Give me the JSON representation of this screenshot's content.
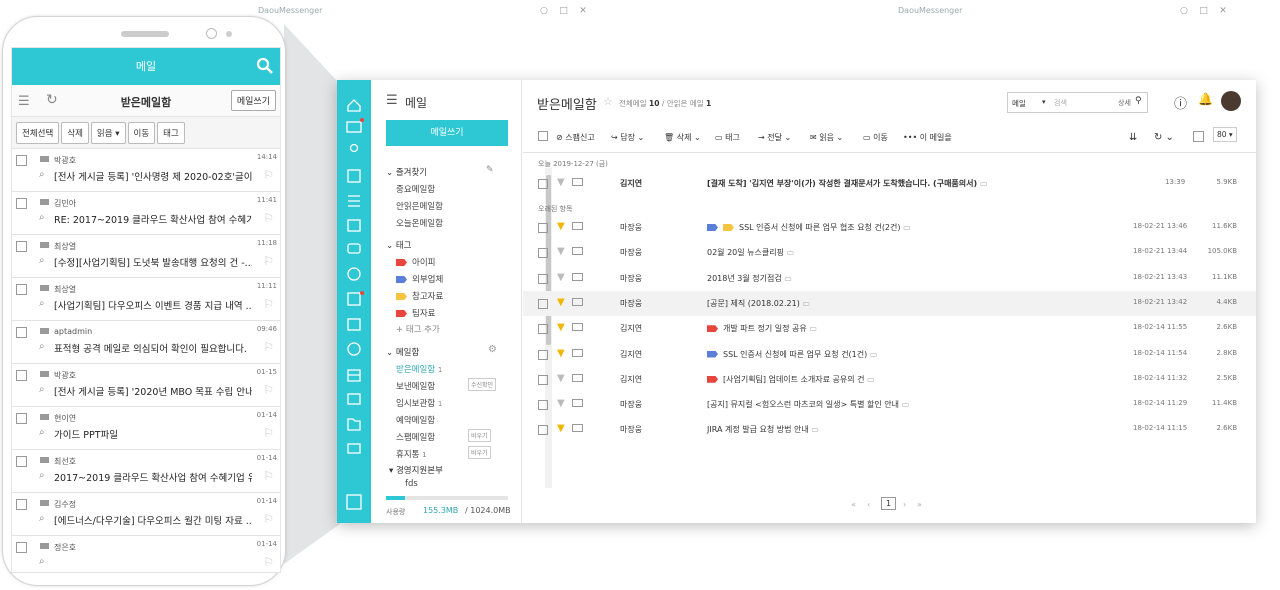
{
  "topstrip": {
    "left_title": "DaouMessenger",
    "right_title": "DaouMessenger"
  },
  "mobile": {
    "header": "메일",
    "folder_title": "받은메일함",
    "write_label": "메일쓰기",
    "tools": [
      "전체선택",
      "삭제",
      "읽음 ▾",
      "이동",
      "태그"
    ],
    "items": [
      {
        "sender": "박광호",
        "time": "14:14",
        "subject": "[전사 게시글 등록] '인사명령 제 2020-02호'글이 ..."
      },
      {
        "sender": "김민아",
        "time": "11:41",
        "subject": "RE: 2017~2019 클라우드 확산사업 참여 수혜기..."
      },
      {
        "sender": "최상열",
        "time": "11:18",
        "subject": "[수정][사업기획팀] 도넛북 발송대행 요청의 건 -..."
      },
      {
        "sender": "최상열",
        "time": "11:11",
        "subject": "[사업기획팀] 다우오피스 이벤트 경품 지급 내역 ..."
      },
      {
        "sender": "aptadmin",
        "time": "09:46",
        "subject": "표적형 공격 메일로 의심되어 확인이 필요합니다."
      },
      {
        "sender": "박광호",
        "time": "01-15",
        "subject": "[전사 게시글 등록] '2020년 MBO 목표 수립 안내 '..."
      },
      {
        "sender": "현이연",
        "time": "01-14",
        "subject": "가이드 PPT파일"
      },
      {
        "sender": "최선호",
        "time": "01-14",
        "subject": "2017~2019 클라우드 확산사업 참여 수혜기업 유..."
      },
      {
        "sender": "김수정",
        "time": "01-14",
        "subject": "[에드너스/다우기술] 다우오피스 월간 미팅 자료 ..."
      },
      {
        "sender": "정은호",
        "time": "01-14",
        "subject": ""
      }
    ]
  },
  "nav": {
    "title": "메일",
    "write": "메일쓰기",
    "fav_title": "즐겨찾기",
    "favs": [
      "중요메일함",
      "안읽은메일함",
      "오늘온메일함"
    ],
    "tag_title": "태그",
    "tags": [
      {
        "name": "아이피",
        "color": "#e8463c"
      },
      {
        "name": "외부업체",
        "color": "#5b7fd8"
      },
      {
        "name": "참고자료",
        "color": "#f5c542"
      },
      {
        "name": "팀자료",
        "color": "#e8463c"
      }
    ],
    "tag_add": "+ 태그 추가",
    "mailbox_title": "메일함",
    "boxes": [
      {
        "name": "받은메일함",
        "count": "1",
        "badge": ""
      },
      {
        "name": "보낸메일함",
        "count": "",
        "badge": "수신확인"
      },
      {
        "name": "임시보관함",
        "count": "1",
        "badge": ""
      },
      {
        "name": "예약메일함",
        "count": "",
        "badge": ""
      },
      {
        "name": "스팸메일함",
        "count": "",
        "badge": "비우기"
      },
      {
        "name": "휴지통",
        "count": "1",
        "badge": "비우기"
      }
    ],
    "group": "경영지원본부",
    "group_sub": "fds",
    "usage_label": "사용량",
    "usage_used": "155.3MB",
    "usage_total": "1024.0MB",
    "usage_fraction": 0.152
  },
  "main": {
    "title": "받은메일함",
    "counts_prefix": "전체메일",
    "total": "10",
    "counts_mid": "/ 안읽은 메일",
    "unread": "1",
    "search_scope": "메일",
    "search_placeholder": "검색",
    "search_detail": "상세",
    "toolbar": [
      "스팸신고",
      "답장",
      "삭제",
      "태그",
      "전달",
      "읽음",
      "이동",
      "이 메일을"
    ],
    "page_size": "80",
    "group_today": "오늘 2019-12-27 (금)",
    "group_old": "오래된 항목",
    "rows": [
      {
        "sender": "김지연",
        "subject": "[결재 도착] '김지연 부장'이(가) 작성한 결재문서가 도착했습니다. (구매품의서)",
        "date": "13:39",
        "size": "5.9KB",
        "bold": true,
        "flag": false,
        "tags": []
      },
      {
        "sender": "마장웅",
        "subject": "SSL 인증서 신청에 따른 업무 협조 요청 건(2건)",
        "date": "18-02-21 13:46",
        "size": "11.6KB",
        "bold": false,
        "flag": true,
        "tags": [
          "#5b7fd8",
          "#f5c542"
        ]
      },
      {
        "sender": "마장웅",
        "subject": "02월 20일 뉴스클리핑",
        "date": "18-02-21 13:44",
        "size": "105.0KB",
        "bold": false,
        "flag": false,
        "tags": []
      },
      {
        "sender": "마장웅",
        "subject": "2018년 3월 정기점검",
        "date": "18-02-21 13:43",
        "size": "11.1KB",
        "bold": false,
        "flag": false,
        "tags": []
      },
      {
        "sender": "마장웅",
        "subject": "[공문] 제직 (2018.02.21)",
        "date": "18-02-21 13:42",
        "size": "4.4KB",
        "bold": false,
        "flag": true,
        "tags": [],
        "hl": true
      },
      {
        "sender": "김지연",
        "subject": "개발 파트 정기 일정 공유",
        "date": "18-02-14 11:55",
        "size": "2.6KB",
        "bold": false,
        "flag": true,
        "tags": [
          "#e8463c"
        ]
      },
      {
        "sender": "김지연",
        "subject": "SSL 인증서 신청에 따른 업무 요청 건(1건)",
        "date": "18-02-14 11:54",
        "size": "2.8KB",
        "bold": false,
        "flag": true,
        "tags": [
          "#5b7fd8"
        ]
      },
      {
        "sender": "김지연",
        "subject": "[사업기획팀] 업데이트 소개자료 공유의 건",
        "date": "18-02-14 11:32",
        "size": "2.5KB",
        "bold": false,
        "flag": false,
        "tags": [
          "#e8463c"
        ]
      },
      {
        "sender": "마장웅",
        "subject": "[공지] 뮤지컬 <험오스런 마츠코의 일생> 특별 할인 안내",
        "date": "18-02-14 11:29",
        "size": "11.4KB",
        "bold": false,
        "flag": false,
        "tags": []
      },
      {
        "sender": "마장웅",
        "subject": "JIRA 계정 발급 요청 방법 안내",
        "date": "18-02-14 11:15",
        "size": "2.6KB",
        "bold": false,
        "flag": true,
        "tags": []
      }
    ],
    "page": "1"
  }
}
